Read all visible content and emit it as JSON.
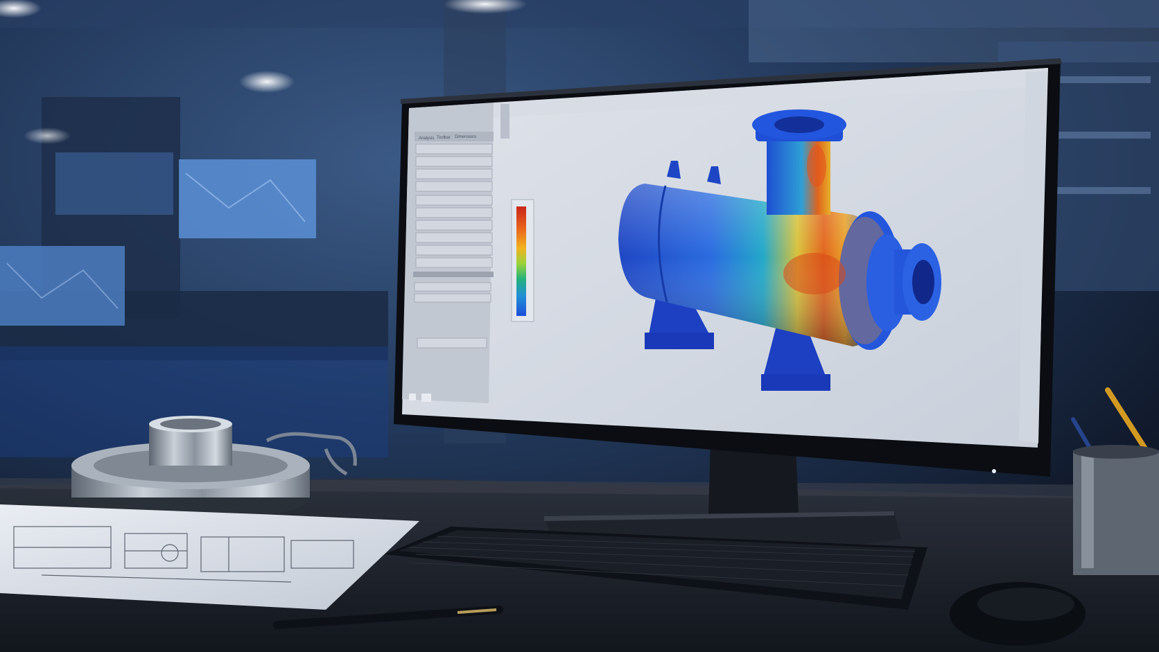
{
  "scene": {
    "kind": "photo",
    "subject": "engineering workstation showing FEA stress simulation",
    "palette": {
      "background": "#1c2b46",
      "desk": "#1f2530",
      "screen": "#d6dbe4",
      "accent_blue": "#1d4fd8",
      "accent_red": "#d93a12"
    }
  },
  "cad_app": {
    "panel_tabs": [
      "Analysis",
      "Toolbar",
      "Dimensions"
    ],
    "legend_colors": [
      "#c8261a",
      "#e8641c",
      "#f2b21f",
      "#9cd23a",
      "#26b27a",
      "#1f8fd6",
      "#1d4fd8"
    ]
  }
}
